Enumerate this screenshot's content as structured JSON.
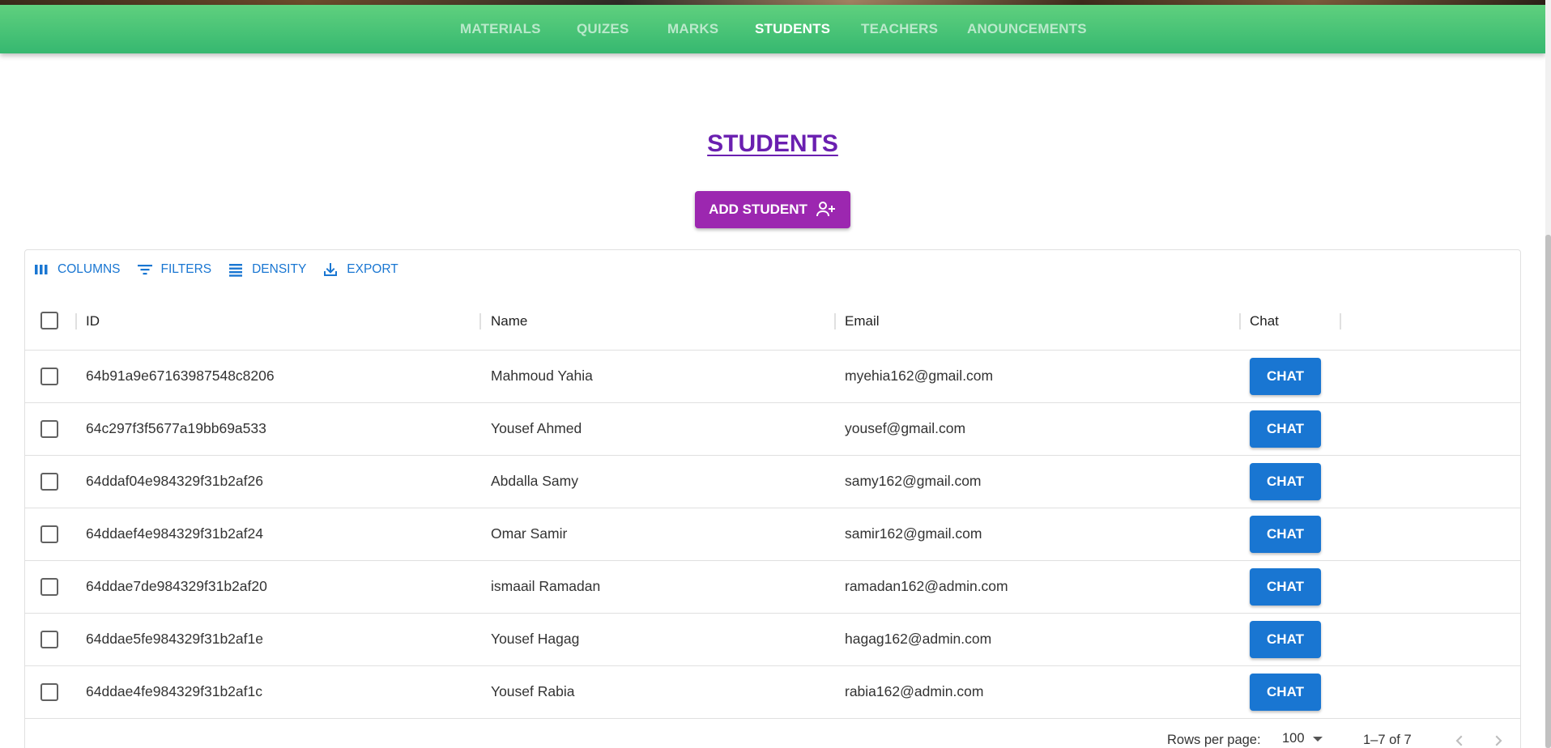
{
  "nav": {
    "items": [
      {
        "label": "MATERIALS",
        "active": false
      },
      {
        "label": "QUIZES",
        "active": false
      },
      {
        "label": "MARKS",
        "active": false
      },
      {
        "label": "STUDENTS",
        "active": true
      },
      {
        "label": "TEACHERS",
        "active": false
      },
      {
        "label": "ANOUNCEMENTS",
        "active": false
      }
    ]
  },
  "page": {
    "title": "STUDENTS",
    "add_button_label": "ADD STUDENT"
  },
  "toolbar": {
    "columns_label": "COLUMNS",
    "filters_label": "FILTERS",
    "density_label": "DENSITY",
    "export_label": "EXPORT"
  },
  "table": {
    "headers": {
      "id": "ID",
      "name": "Name",
      "email": "Email",
      "chat": "Chat"
    },
    "chat_button_label": "CHAT",
    "rows": [
      {
        "id": "64b91a9e67163987548c8206",
        "name": "Mahmoud Yahia",
        "email": "myehia162@gmail.com"
      },
      {
        "id": "64c297f3f5677a19bb69a533",
        "name": "Yousef Ahmed",
        "email": "yousef@gmail.com"
      },
      {
        "id": "64ddaf04e984329f31b2af26",
        "name": "Abdalla Samy",
        "email": "samy162@gmail.com"
      },
      {
        "id": "64ddaef4e984329f31b2af24",
        "name": "Omar Samir",
        "email": "samir162@gmail.com"
      },
      {
        "id": "64ddae7de984329f31b2af20",
        "name": "ismaail Ramadan",
        "email": "ramadan162@admin.com"
      },
      {
        "id": "64ddae5fe984329f31b2af1e",
        "name": "Yousef Hagag",
        "email": "hagag162@admin.com"
      },
      {
        "id": "64ddae4fe984329f31b2af1c",
        "name": "Yousef Rabia",
        "email": "rabia162@admin.com"
      }
    ]
  },
  "pagination": {
    "rows_per_page_label": "Rows per page:",
    "rows_per_page_value": "100",
    "range_text": "1–7 of 7"
  },
  "colors": {
    "nav_green": "#36b870",
    "title_purple": "#6a1fb0",
    "add_button": "#9c27b0",
    "primary_blue": "#1976d2"
  }
}
